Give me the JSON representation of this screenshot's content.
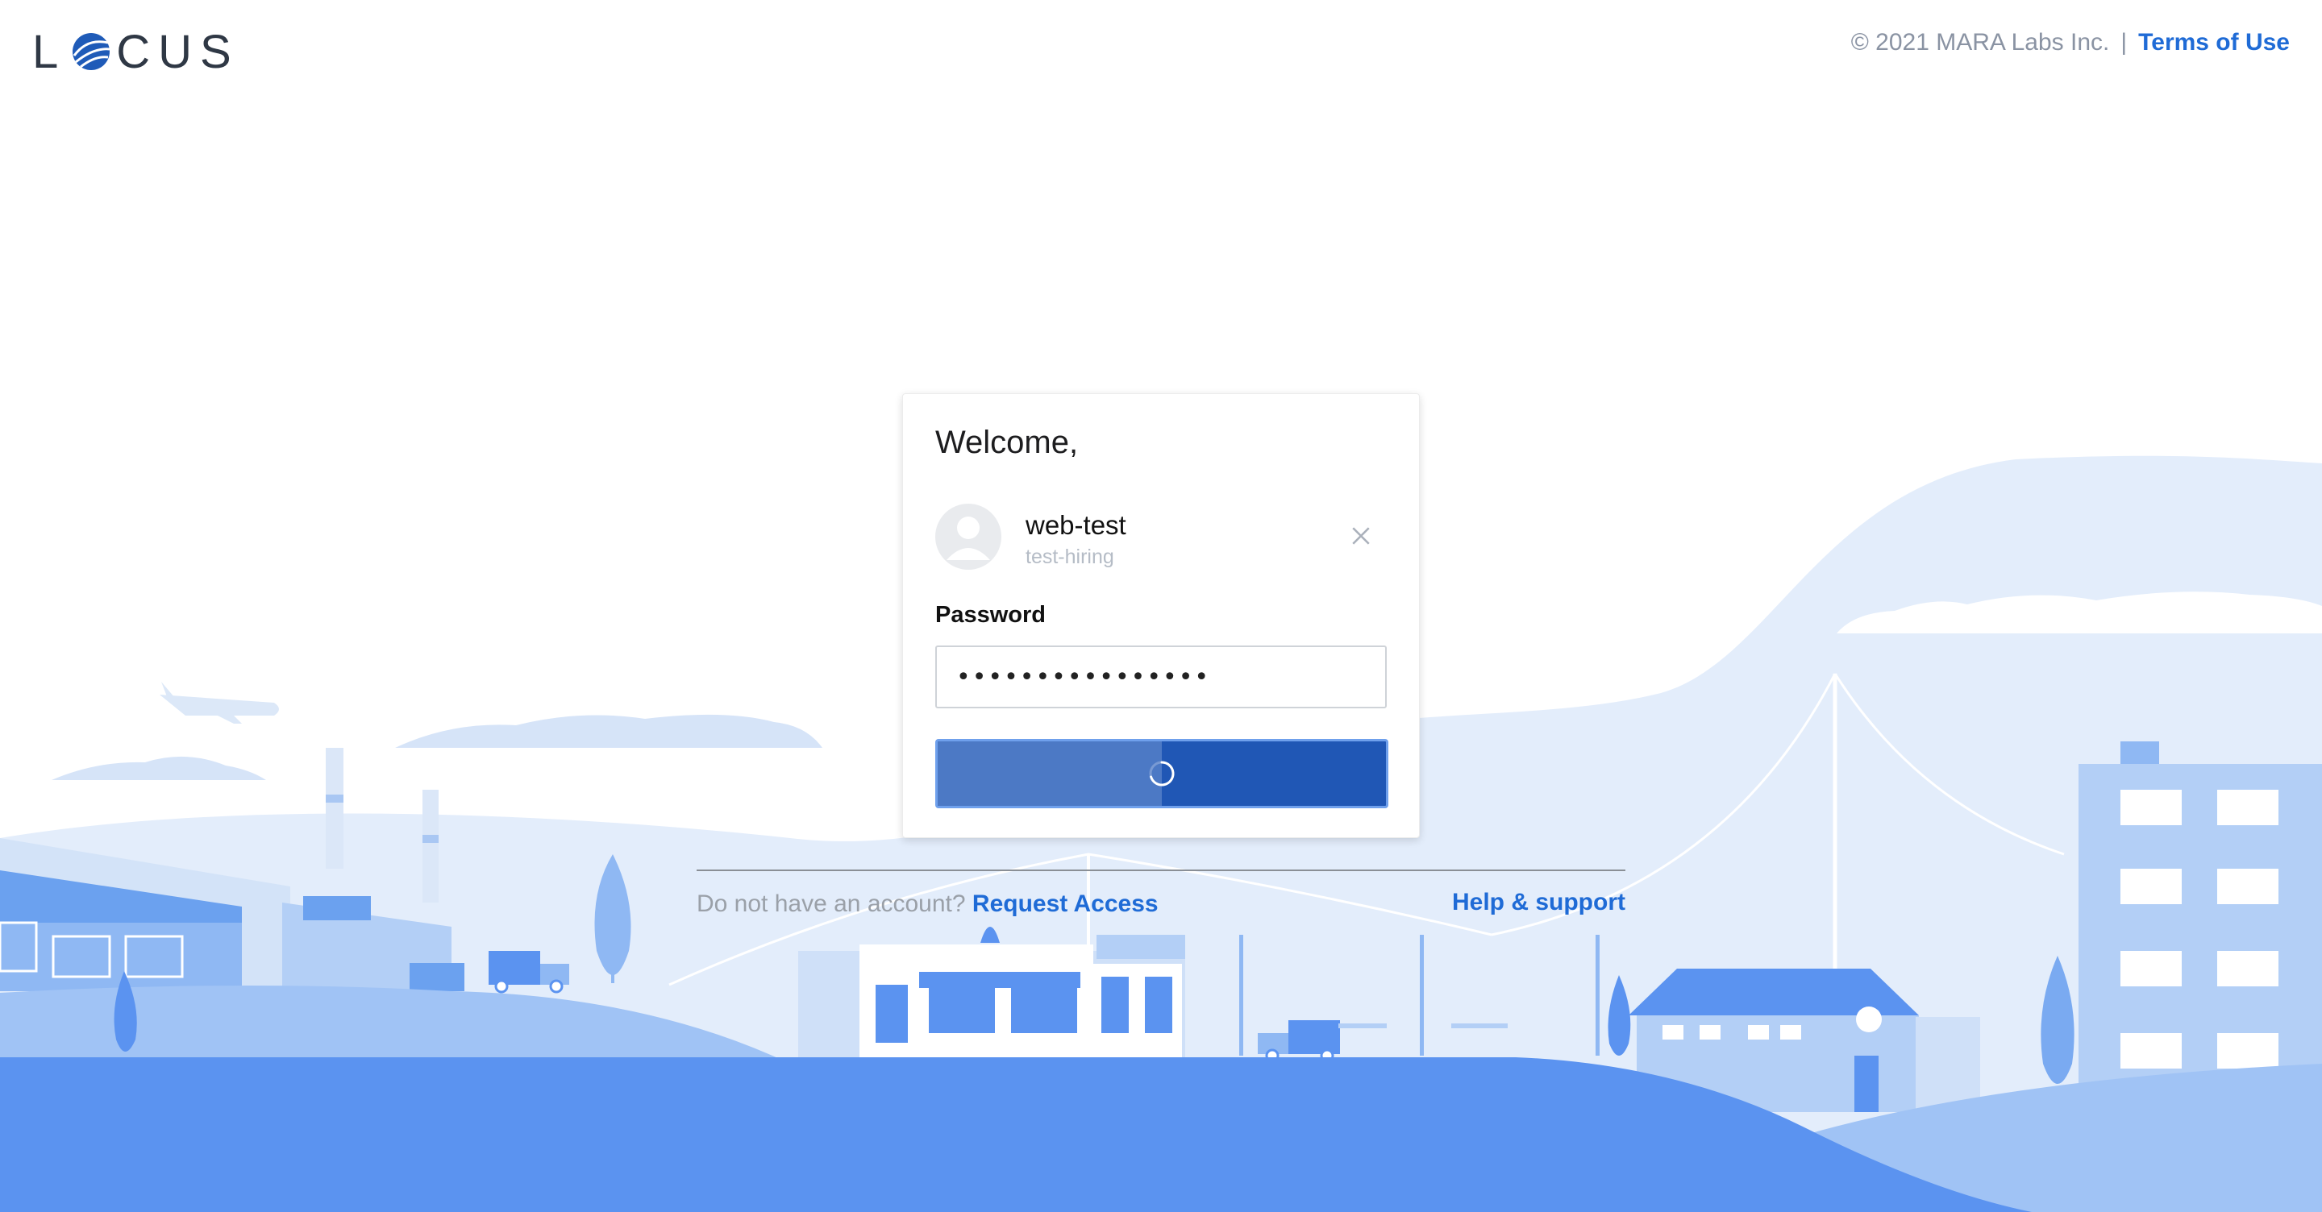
{
  "header": {
    "logo_prefix": "L",
    "logo_suffix": "CUS",
    "copyright": "© 2021 MARA Labs Inc.",
    "separator": "|",
    "terms_link": "Terms of Use"
  },
  "login_card": {
    "welcome": "Welcome,",
    "user": {
      "name": "web-test",
      "org": "test-hiring"
    },
    "password_label": "Password",
    "password_value": "................",
    "submit_progress": 0.5
  },
  "footer_links": {
    "no_account_text": "Do not have an account?",
    "request_access": "Request Access",
    "help_support": "Help & support"
  },
  "colors": {
    "brand_blue": "#1f6bd6",
    "button_blue": "#2057b5",
    "ground_blue": "#5b93f0",
    "sky_pale": "#e3edfb"
  },
  "icons": {
    "close": "close-icon",
    "avatar": "user-avatar-icon",
    "spinner": "loading-spinner-icon",
    "logo_globe": "globe-icon"
  }
}
